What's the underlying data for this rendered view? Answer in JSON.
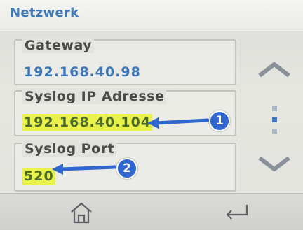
{
  "header": {
    "title": "Netzwerk"
  },
  "fields": {
    "gateway": {
      "label": "Gateway",
      "value": "192.168.40.98"
    },
    "syslog_ip": {
      "label": "Syslog IP Adresse",
      "value": "192.168.40.104"
    },
    "syslog_port": {
      "label": "Syslog Port",
      "value": "520"
    }
  },
  "annotations": {
    "badge_1": "1",
    "badge_2": "2"
  },
  "icons": {
    "scroll_up": "chevron-up-icon",
    "scroll_down": "chevron-down-icon",
    "home": "home-icon",
    "back": "return-icon"
  },
  "colors": {
    "accent_blue": "#3d77b6",
    "highlight": "#e9f24a",
    "annotation_blue": "#2f66d0"
  }
}
